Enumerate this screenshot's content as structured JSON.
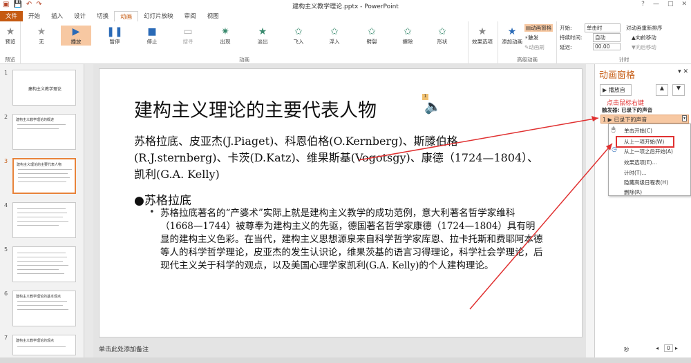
{
  "window": {
    "title": "建构主义教学理论.pptx - PowerPoint",
    "controls": [
      "?",
      "—",
      "□",
      "✕"
    ]
  },
  "tabs": [
    {
      "label": "文件",
      "state": "file"
    },
    {
      "label": "开始"
    },
    {
      "label": "插入"
    },
    {
      "label": "设计"
    },
    {
      "label": "切换"
    },
    {
      "label": "动画",
      "state": "active"
    },
    {
      "label": "幻灯片放映"
    },
    {
      "label": "审阅"
    },
    {
      "label": "视图"
    }
  ],
  "ribbon": {
    "preview_label": "预览",
    "preview_group": "预览",
    "effects": [
      {
        "label": "无",
        "icon": "star-outline-icon"
      },
      {
        "label": "播放",
        "icon": "play-icon",
        "selected": true
      },
      {
        "label": "暂停",
        "icon": "pause-icon"
      },
      {
        "label": "停止",
        "icon": "stop-icon"
      },
      {
        "label": "搜寻",
        "icon": "seek-icon"
      },
      {
        "label": "出现",
        "icon": "appear-star-icon"
      },
      {
        "label": "淡出",
        "icon": "fade-star-icon"
      },
      {
        "label": "飞入",
        "icon": "fly-in-star-icon"
      },
      {
        "label": "浮入",
        "icon": "float-in-star-icon"
      },
      {
        "label": "劈裂",
        "icon": "split-star-icon"
      },
      {
        "label": "擦除",
        "icon": "wipe-star-icon"
      },
      {
        "label": "形状",
        "icon": "shape-star-icon"
      }
    ],
    "effect_options": "效果选项",
    "animation_group": "动画",
    "add_animation": "添加动画",
    "animation_pane": "动画窗格",
    "trigger": "触发",
    "painter": "动画刷",
    "advanced_group": "高级动画",
    "start_label": "开始:",
    "start_value": "单击时",
    "duration_label": "持续时间:",
    "duration_value": "自动",
    "delay_label": "延迟:",
    "delay_value": "00.00",
    "reorder_label": "对动画重新排序",
    "move_earlier": "向前移动",
    "move_later": "向后移动",
    "timing_group": "计时"
  },
  "thumbnails": [
    {
      "num": "1",
      "title": "建构主义教学理论"
    },
    {
      "num": "2",
      "title": "建构主义教学理论的概述"
    },
    {
      "num": "3",
      "title": "建构主义理论的主要代表人物",
      "selected": true
    },
    {
      "num": "4",
      "title": ""
    },
    {
      "num": "5",
      "title": ""
    },
    {
      "num": "6",
      "title": "建构主义教学理论的基本观点"
    },
    {
      "num": "7",
      "title": "建构主义教学理论的观点"
    }
  ],
  "slide": {
    "title": "建构主义理论的主要代表人物",
    "body": "苏格拉底、皮亚杰(J.Piaget)、科恩伯格(O.Kernberg)、斯滕伯格(R.J.sternberg)、卡茨(D.Katz)、维果斯基(Vogotsgy)、康德（1724—1804）、凯利(G.A. Kelly)",
    "bullet": "●苏格拉底",
    "sub_bullet": "苏格拉底著名的“产婆术”实际上就是建构主义教学的成功范例，意大利著名哲学家维科（1668—1744）被尊奉为建构主义的先驱，德国著名哲学家康德（1724—1804）具有明显的建构主义色彩。在当代，建构主义思想源泉来自科学哲学家库恩、拉卡托斯和费耶阿本德等人的科学哲学理论，皮亚杰的发生认识论，维果茨基的语言习得理论，科学社会学理论，后现代主义关于科学的观点，以及美国心理学家凯利(G.A. Kelly)的个人建构理论。",
    "notes": "单击此处添加备注"
  },
  "pane": {
    "title": "动画窗格",
    "play_button": "播放自",
    "annotation": "点击鼠标右键",
    "trigger_label": "触发器: 已录下的声音",
    "item_num": "1",
    "item_label": "已录下的声音",
    "menu": [
      {
        "label": "单击开始(C)"
      },
      {
        "label": "从上一项开始(W)",
        "highlight": true
      },
      {
        "label": "从上一项之后开始(A)"
      },
      {
        "label": "效果选项(E)..."
      },
      {
        "label": "计时(T)..."
      },
      {
        "label": "隐藏高级日程表(H)"
      },
      {
        "label": "删除(R)"
      }
    ],
    "seconds_label": "秒",
    "seconds_value": "0"
  },
  "colors": {
    "accent": "#c55a11",
    "annotation": "#e03030",
    "selected_fill": "#f7c8a2"
  }
}
